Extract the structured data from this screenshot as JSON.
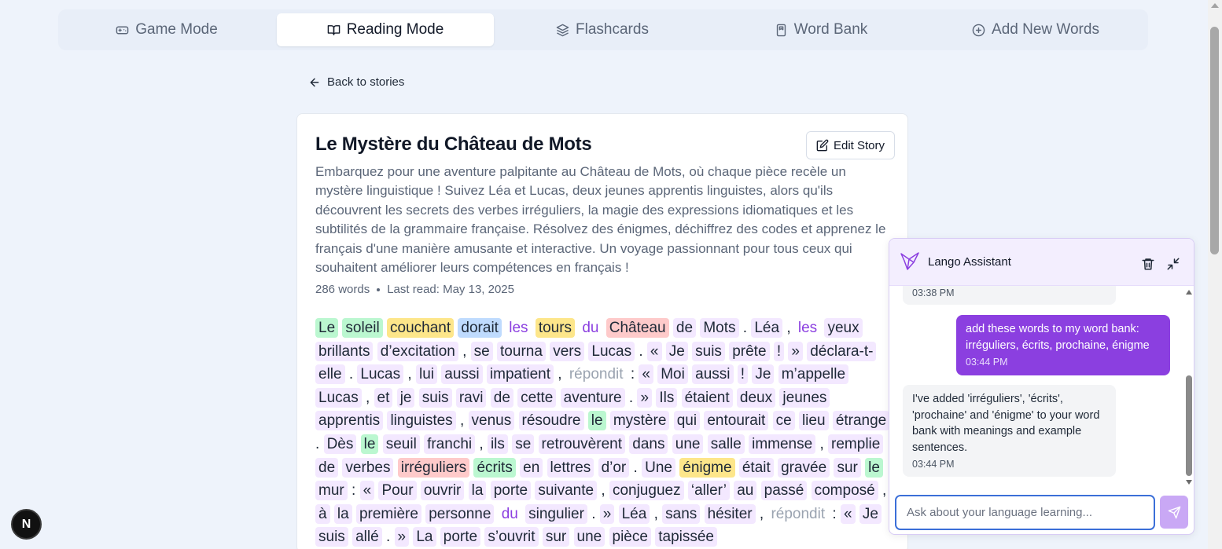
{
  "tabs": [
    {
      "label": "Game Mode",
      "icon": "gamepad-icon",
      "active": false
    },
    {
      "label": "Reading Mode",
      "icon": "book-open-icon",
      "active": true
    },
    {
      "label": "Flashcards",
      "icon": "layers-icon",
      "active": false
    },
    {
      "label": "Word Bank",
      "icon": "book-icon",
      "active": false
    },
    {
      "label": "Add New Words",
      "icon": "plus-circle-icon",
      "active": false
    }
  ],
  "back_label": "Back to stories",
  "story": {
    "title": "Le Mystère du Château de Mots",
    "edit_label": "Edit Story",
    "description": "Embarquez pour une aventure palpitante au Château de Mots, où chaque pièce recèle un mystère linguistique ! Suivez Léa et Lucas, deux jeunes apprentis linguistes, alors qu'ils découvrent les secrets des verbes irréguliers, la magie des expressions idiomatiques et les subtilités de la grammaire française. Résolvez des énigmes, déchiffrez des codes et apprenez le français d'une manière amusante et interactive. Un voyage passionnant pour tous ceux qui souhaitent améliorer leurs compétences en français !",
    "word_count": "286 words",
    "last_read": "Last read: May 13, 2025"
  },
  "highlight_colors": {
    "known": "#bbf7d0",
    "learning": "#fde68a",
    "review": "#bfdbfe",
    "new": "#fecaca",
    "default": "#f3e8ff",
    "function_word": "#8b3fe0",
    "ignored": "#9aa3b0"
  },
  "tokens": [
    {
      "t": "Le",
      "c": "green"
    },
    {
      "t": "soleil",
      "c": "green"
    },
    {
      "t": "couchant",
      "c": "yellow"
    },
    {
      "t": "dorait",
      "c": "blue"
    },
    {
      "t": "les",
      "c": "purple"
    },
    {
      "t": "tours",
      "c": "yellow"
    },
    {
      "t": "du",
      "c": "purple"
    },
    {
      "t": "Château",
      "c": "red"
    },
    {
      "t": "de",
      "c": "w"
    },
    {
      "t": "Mots",
      "c": "w"
    },
    {
      "t": ".",
      "c": "p"
    },
    {
      "t": "Léa",
      "c": "w"
    },
    {
      "t": ",",
      "c": "p"
    },
    {
      "t": "les",
      "c": "purple"
    },
    {
      "t": "yeux",
      "c": "w"
    },
    {
      "t": "brillants",
      "c": "w"
    },
    {
      "t": "d’excitation",
      "c": "w"
    },
    {
      "t": ",",
      "c": "p"
    },
    {
      "t": "se",
      "c": "w"
    },
    {
      "t": "tourna",
      "c": "w"
    },
    {
      "t": "vers",
      "c": "w"
    },
    {
      "t": "Lucas",
      "c": "w"
    },
    {
      "t": ".",
      "c": "p"
    },
    {
      "t": "«",
      "c": "w"
    },
    {
      "t": "Je",
      "c": "w"
    },
    {
      "t": "suis",
      "c": "w"
    },
    {
      "t": "prête",
      "c": "w"
    },
    {
      "t": "!",
      "c": "w"
    },
    {
      "t": "»",
      "c": "w"
    },
    {
      "t": "déclara-t-",
      "c": "w"
    },
    {
      "t": "elle",
      "c": "w"
    },
    {
      "t": ".",
      "c": "p"
    },
    {
      "t": "Lucas",
      "c": "w"
    },
    {
      "t": ",",
      "c": "p"
    },
    {
      "t": "lui",
      "c": "w"
    },
    {
      "t": "aussi",
      "c": "w"
    },
    {
      "t": "impatient",
      "c": "w"
    },
    {
      "t": ",",
      "c": "p"
    },
    {
      "t": "répondit",
      "c": "gray"
    },
    {
      "t": ":",
      "c": "p"
    },
    {
      "t": "«",
      "c": "w"
    },
    {
      "t": "Moi",
      "c": "w"
    },
    {
      "t": "aussi",
      "c": "w"
    },
    {
      "t": "!",
      "c": "w"
    },
    {
      "t": "Je",
      "c": "w"
    },
    {
      "t": "m’appelle",
      "c": "w"
    },
    {
      "t": "Lucas",
      "c": "w"
    },
    {
      "t": ",",
      "c": "p"
    },
    {
      "t": "et",
      "c": "w"
    },
    {
      "t": "je",
      "c": "w"
    },
    {
      "t": "suis",
      "c": "w"
    },
    {
      "t": "ravi",
      "c": "w"
    },
    {
      "t": "de",
      "c": "w"
    },
    {
      "t": "cette",
      "c": "w"
    },
    {
      "t": "aventure",
      "c": "w"
    },
    {
      "t": ".",
      "c": "p"
    },
    {
      "t": "»",
      "c": "w"
    },
    {
      "t": "Ils",
      "c": "w"
    },
    {
      "t": "étaient",
      "c": "w"
    },
    {
      "t": "deux",
      "c": "w"
    },
    {
      "t": "jeunes",
      "c": "w"
    },
    {
      "t": "apprentis",
      "c": "w"
    },
    {
      "t": "linguistes",
      "c": "w"
    },
    {
      "t": ",",
      "c": "p"
    },
    {
      "t": "venus",
      "c": "w"
    },
    {
      "t": "résoudre",
      "c": "w"
    },
    {
      "t": "le",
      "c": "green"
    },
    {
      "t": "mystère",
      "c": "w"
    },
    {
      "t": "qui",
      "c": "w"
    },
    {
      "t": "entourait",
      "c": "w"
    },
    {
      "t": "ce",
      "c": "w"
    },
    {
      "t": "lieu",
      "c": "w"
    },
    {
      "t": "étrange",
      "c": "w"
    },
    {
      "t": ".",
      "c": "p"
    },
    {
      "t": "Dès",
      "c": "w"
    },
    {
      "t": "le",
      "c": "green"
    },
    {
      "t": "seuil",
      "c": "w"
    },
    {
      "t": "franchi",
      "c": "w"
    },
    {
      "t": ",",
      "c": "p"
    },
    {
      "t": "ils",
      "c": "w"
    },
    {
      "t": "se",
      "c": "w"
    },
    {
      "t": "retrouvèrent",
      "c": "w"
    },
    {
      "t": "dans",
      "c": "w"
    },
    {
      "t": "une",
      "c": "w"
    },
    {
      "t": "salle",
      "c": "w"
    },
    {
      "t": "immense",
      "c": "w"
    },
    {
      "t": ",",
      "c": "p"
    },
    {
      "t": "remplie",
      "c": "w"
    },
    {
      "t": "de",
      "c": "w"
    },
    {
      "t": "verbes",
      "c": "w"
    },
    {
      "t": "irréguliers",
      "c": "red"
    },
    {
      "t": "écrits",
      "c": "green"
    },
    {
      "t": "en",
      "c": "w"
    },
    {
      "t": "lettres",
      "c": "w"
    },
    {
      "t": "d’or",
      "c": "w"
    },
    {
      "t": ".",
      "c": "p"
    },
    {
      "t": "Une",
      "c": "w"
    },
    {
      "t": "énigme",
      "c": "yellow"
    },
    {
      "t": "était",
      "c": "w"
    },
    {
      "t": "gravée",
      "c": "w"
    },
    {
      "t": "sur",
      "c": "w"
    },
    {
      "t": "le",
      "c": "green"
    },
    {
      "t": "mur",
      "c": "w"
    },
    {
      "t": ":",
      "c": "p"
    },
    {
      "t": "«",
      "c": "w"
    },
    {
      "t": "Pour",
      "c": "w"
    },
    {
      "t": "ouvrir",
      "c": "w"
    },
    {
      "t": "la",
      "c": "w"
    },
    {
      "t": "porte",
      "c": "w"
    },
    {
      "t": "suivante",
      "c": "w"
    },
    {
      "t": ",",
      "c": "p"
    },
    {
      "t": "conjuguez",
      "c": "w"
    },
    {
      "t": "‘aller’",
      "c": "w"
    },
    {
      "t": "au",
      "c": "w"
    },
    {
      "t": "passé",
      "c": "w"
    },
    {
      "t": "composé",
      "c": "w"
    },
    {
      "t": ",",
      "c": "p"
    },
    {
      "t": "à",
      "c": "w"
    },
    {
      "t": "la",
      "c": "w"
    },
    {
      "t": "première",
      "c": "w"
    },
    {
      "t": "personne",
      "c": "w"
    },
    {
      "t": "du",
      "c": "purple"
    },
    {
      "t": "singulier",
      "c": "w"
    },
    {
      "t": ".",
      "c": "p"
    },
    {
      "t": "»",
      "c": "w"
    },
    {
      "t": "Léa",
      "c": "w"
    },
    {
      "t": ",",
      "c": "p"
    },
    {
      "t": "sans",
      "c": "w"
    },
    {
      "t": "hésiter",
      "c": "w"
    },
    {
      "t": ",",
      "c": "p"
    },
    {
      "t": "répondit",
      "c": "gray"
    },
    {
      "t": ":",
      "c": "p"
    },
    {
      "t": "«",
      "c": "w"
    },
    {
      "t": "Je",
      "c": "w"
    },
    {
      "t": "suis",
      "c": "w"
    },
    {
      "t": "allé",
      "c": "w"
    },
    {
      "t": ".",
      "c": "p"
    },
    {
      "t": "»",
      "c": "w"
    },
    {
      "t": "La",
      "c": "w"
    },
    {
      "t": "porte",
      "c": "w"
    },
    {
      "t": "s’ouvrit",
      "c": "w"
    },
    {
      "t": "sur",
      "c": "w"
    },
    {
      "t": "une",
      "c": "w"
    },
    {
      "t": "pièce",
      "c": "w"
    },
    {
      "t": "tapissée",
      "c": "w"
    }
  ],
  "chat": {
    "title": "Lango Assistant",
    "prev_time": "03:38 PM",
    "user_message": "add these words to my word bank: irréguliers, écrits, prochaine, énigme",
    "user_time": "03:44 PM",
    "bot_message": "I've added 'irréguliers', 'écrits', 'prochaine' and 'énigme' to your word bank with meanings and example sentences.",
    "bot_time": "03:44 PM",
    "input_placeholder": "Ask about your language learning..."
  },
  "badge_letter": "N"
}
